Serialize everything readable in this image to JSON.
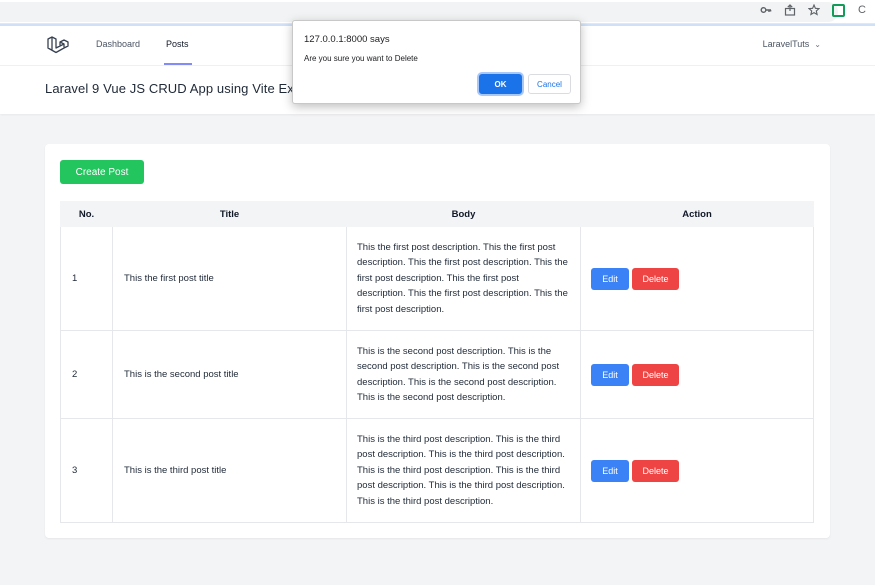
{
  "browser": {
    "icons": [
      "key-icon",
      "share-icon",
      "star-icon",
      "extension-icon",
      "profile-icon"
    ],
    "profile_initial": "C"
  },
  "navbar": {
    "links": [
      {
        "label": "Dashboard",
        "active": false
      },
      {
        "label": "Posts",
        "active": true
      }
    ],
    "user_name": "LaravelTuts"
  },
  "header": {
    "title": "Laravel 9 Vue JS CRUD App using Vite Exa"
  },
  "main": {
    "create_button": "Create Post",
    "table": {
      "columns": [
        "No.",
        "Title",
        "Body",
        "Action"
      ],
      "rows": [
        {
          "no": "1",
          "title": "This the first post title",
          "body": "This the first post description. This the first post description. This the first post description. This the first post description. This the first post description. This the first post description. This the first post description."
        },
        {
          "no": "2",
          "title": "This is the second post title",
          "body": "This is the second post description. This is the second post description. This is the second post description. This is the second post description. This is the second post description."
        },
        {
          "no": "3",
          "title": "This is the third post title",
          "body": "This is the third post description. This is the third post description. This is the third post description. This is the third post description. This is the third post description. This is the third post description. This is the third post description."
        }
      ],
      "edit_label": "Edit",
      "delete_label": "Delete"
    }
  },
  "dialog": {
    "origin": "127.0.0.1:8000 says",
    "message": "Are you sure you want to Delete",
    "ok_label": "OK",
    "cancel_label": "Cancel"
  },
  "colors": {
    "create": "#22c55e",
    "edit": "#3b82f6",
    "delete": "#ef4444",
    "dialog_ok": "#1a73e8",
    "nav_active": "#818cf8"
  }
}
